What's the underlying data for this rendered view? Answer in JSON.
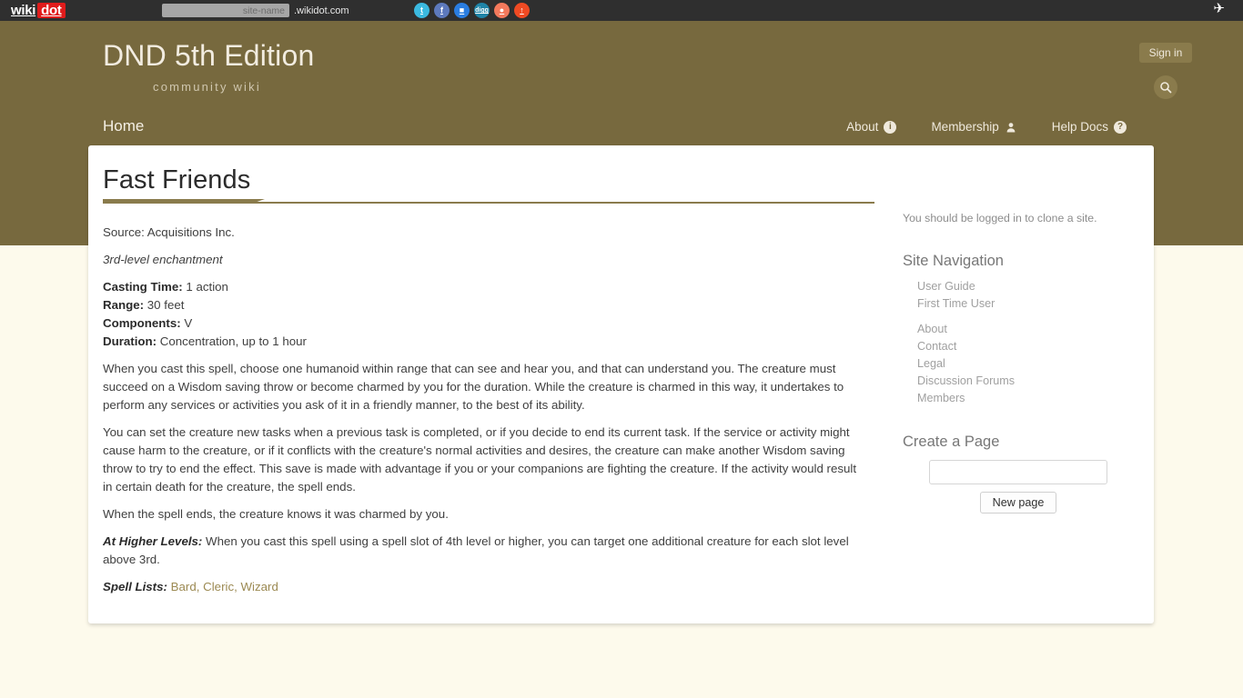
{
  "topbar": {
    "brand_first": "wiki",
    "brand_second": "dot",
    "site_name_placeholder": "site-name",
    "site_name_value": "",
    "domain_suffix": ".wikidot.com",
    "social": [
      {
        "name": "twitter-icon",
        "glyph": "t"
      },
      {
        "name": "facebook-icon",
        "glyph": "f"
      },
      {
        "name": "delicious-icon",
        "glyph": "■"
      },
      {
        "name": "digg-icon",
        "glyph": "digg"
      },
      {
        "name": "reddit-icon",
        "glyph": "●"
      },
      {
        "name": "stumbleupon-icon",
        "glyph": "↑"
      }
    ],
    "plane_icon": "✈"
  },
  "header": {
    "title": "DND 5th Edition",
    "subtitle": "community wiki",
    "sign_in_label": "Sign in",
    "search_icon": "search-icon",
    "accent_color": "#77693e",
    "button_color": "#8a7b4c"
  },
  "nav": {
    "home_label": "Home",
    "items": [
      {
        "label": "About",
        "icon": "info-icon",
        "glyph": "i"
      },
      {
        "label": "Membership",
        "icon": "person-icon",
        "glyph": "♟"
      },
      {
        "label": "Help Docs",
        "icon": "question-icon",
        "glyph": "?"
      }
    ]
  },
  "page": {
    "title": "Fast Friends",
    "source": "Source: Acquisitions Inc.",
    "level_school": "3rd-level enchantment",
    "stats": [
      {
        "label": "Casting Time:",
        "value": " 1 action"
      },
      {
        "label": "Range:",
        "value": " 30 feet"
      },
      {
        "label": "Components:",
        "value": " V"
      },
      {
        "label": "Duration:",
        "value": " Concentration, up to 1 hour"
      }
    ],
    "paragraph_1": "When you cast this spell, choose one humanoid within range that can see and hear you, and that can understand you. The creature must succeed on a Wisdom saving throw or become charmed by you for the duration. While the creature is charmed in this way, it undertakes to perform any services or activities you ask of it in a friendly manner, to the best of its ability.",
    "paragraph_2": "You can set the creature new tasks when a previous task is completed, or if you decide to end its current task. If the service or activity might cause harm to the creature, or if it conflicts with the creature's normal activities and desires, the creature can make another Wisdom saving throw to try to end the effect. This save is made with advantage if you or your companions are fighting the creature. If the activity would result in certain death for the creature, the spell ends.",
    "paragraph_3": "When the spell ends, the creature knows it was charmed by you.",
    "higher_levels_label": "At Higher Levels:",
    "higher_levels_text": " When you cast this spell using a spell slot of 4th level or higher, you can target one additional creature for each slot level above 3rd.",
    "spell_lists_label": "Spell Lists:",
    "spell_lists": [
      {
        "label": "Bard",
        "separator": ", "
      },
      {
        "label": "Cleric",
        "separator": ", "
      },
      {
        "label": "Wizard",
        "separator": ""
      }
    ],
    "link_color": "#9c8a53"
  },
  "sidebar": {
    "clone_note": "You should be logged in to clone a site.",
    "nav_heading": "Site Navigation",
    "nav_group_1": [
      {
        "label": "User Guide"
      },
      {
        "label": "First Time User"
      }
    ],
    "nav_group_2": [
      {
        "label": "About"
      },
      {
        "label": "Contact"
      },
      {
        "label": "Legal"
      },
      {
        "label": "Discussion Forums"
      },
      {
        "label": "Members"
      }
    ],
    "create_heading": "Create a Page",
    "new_page_value": "",
    "new_page_placeholder": "",
    "new_page_button": "New page"
  }
}
